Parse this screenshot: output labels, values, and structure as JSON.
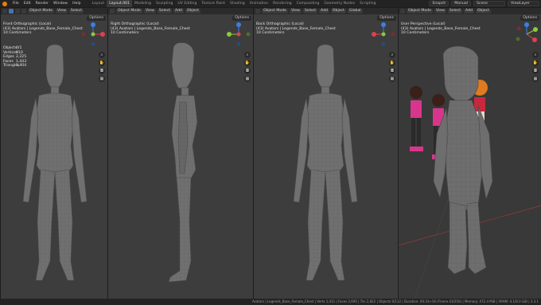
{
  "menubar": {
    "menus": [
      "File",
      "Edit",
      "Render",
      "Window",
      "Help"
    ],
    "workspaces": [
      "Layout",
      "Layout.001",
      "Modeling",
      "Sculpting",
      "UV Editing",
      "Texture Paint",
      "Shading",
      "Animation",
      "Rendering",
      "Compositing",
      "Geometry Nodes",
      "Scripting"
    ],
    "active_workspace": "Layout.001",
    "right": {
      "snapshot": "Snapsh",
      "manual": "Manual",
      "scene": "Scene",
      "view_layer": "ViewLayer"
    }
  },
  "viewport_header": {
    "mode": "Object Mode",
    "menus": [
      "View",
      "Select",
      "Add",
      "Object"
    ],
    "orientation": "Global",
    "options": "Options"
  },
  "viewports": [
    {
      "title": "Front Orthographic (Local)",
      "collection": "(43) Avatars | Legends_Base_Female_Chest",
      "units": "10 Centimeters",
      "stats": [
        {
          "label": "Objects",
          "value": "0/1"
        },
        {
          "label": "Vertices",
          "value": "910"
        },
        {
          "label": "Edges",
          "value": "2,225"
        },
        {
          "label": "Faces",
          "value": "1,443"
        },
        {
          "label": "Triangles",
          "value": "1,404"
        }
      ]
    },
    {
      "title": "Right Orthographic (Local)",
      "collection": "(43) Avatars | Legends_Base_Female_Chest",
      "units": "10 Centimeters"
    },
    {
      "title": "Back Orthographic (Local)",
      "collection": "(43) Avatars | Legends_Base_Female_Chest",
      "units": "10 Centimeters"
    },
    {
      "title": "User Perspective (Local)",
      "collection": "(43) Avatars | Legends_Base_Female_Chest",
      "units": "10 Centimeters"
    }
  ],
  "gizmo_axes": {
    "x": "X",
    "y": "Y",
    "z": "Z"
  },
  "colors": {
    "x_axis": "#e0404e",
    "y_axis": "#8cc93c",
    "z_axis": "#3d7ee6",
    "accent": "#4772b3",
    "mesh": "#6e6e6e",
    "wire": "#4a4a4a",
    "character_pink": "#d8368c"
  },
  "status_bar": "Avatars | Legends_Base_Female_Chest | Verts 1,411 | Faces 2,695 | Tris 2,822 | Objects 0/112 | Duration: 00:33+16 (Frame 43/250) | Memory: 472.4 MiB | VRAM: 4.1/6.0 GiB | 3.3.1"
}
